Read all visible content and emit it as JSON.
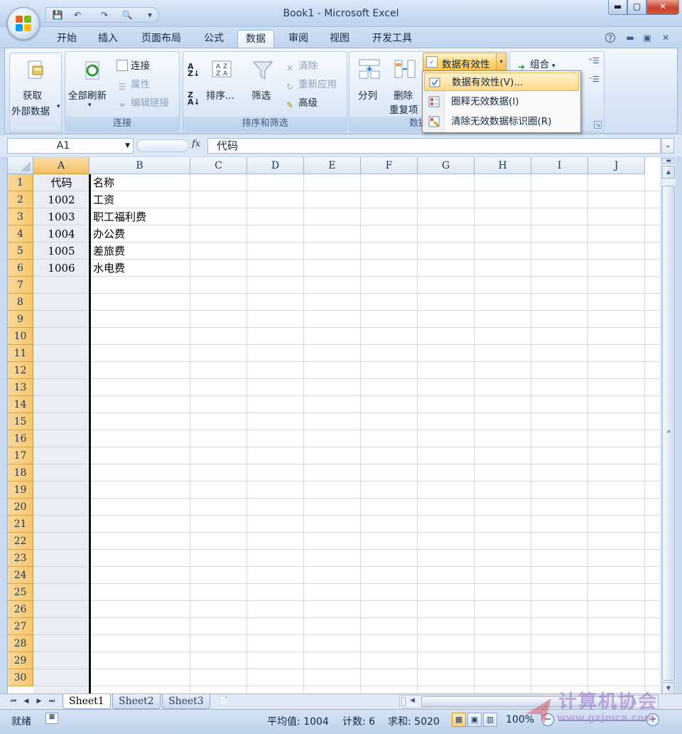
{
  "window": {
    "title": "Book1 - Microsoft Excel",
    "minimize": "▬",
    "maximize": "▢",
    "close": "✕"
  },
  "qat": {
    "save": "💾",
    "undo": "↶",
    "redo": "↷",
    "preview": "🔍",
    "customize": "▾"
  },
  "tabs": [
    "开始",
    "插入",
    "页面布局",
    "公式",
    "数据",
    "审阅",
    "视图",
    "开发工具"
  ],
  "active_tab": "数据",
  "ribbon": {
    "get_external_data": {
      "line1": "获取",
      "line2": "外部数据"
    },
    "connections": {
      "refresh_all": "全部刷新",
      "connections": "连接",
      "properties": "属性",
      "edit_links": "编辑链接",
      "label": "连接"
    },
    "sort_filter": {
      "sort": "排序...",
      "filter": "筛选",
      "clear": "清除",
      "reapply": "重新应用",
      "advanced": "高级",
      "label": "排序和筛选"
    },
    "data_tools": {
      "text_to_columns": "分列",
      "remove_dup_line1": "删除",
      "remove_dup_line2": "重复项",
      "data_validation": "数据有效性",
      "label": "数据"
    },
    "outline": {
      "group": "组合"
    }
  },
  "dropdown_menu": {
    "items": [
      {
        "label": "数据有效性(V)...",
        "highlighted": true
      },
      {
        "label": "圈释无效数据(I)",
        "highlighted": false
      },
      {
        "label": "清除无效数据标识圈(R)",
        "highlighted": false
      }
    ]
  },
  "formula_bar": {
    "name_box": "A1",
    "fx": "fx",
    "value": "代码"
  },
  "sheet": {
    "columns": [
      "A",
      "B",
      "C",
      "D",
      "E",
      "F",
      "G",
      "H",
      "I",
      "J"
    ],
    "selected_column": "A",
    "row_numbers": [
      "1",
      "2",
      "3",
      "4",
      "5",
      "6",
      "7",
      "8",
      "9",
      "10",
      "11",
      "12",
      "13",
      "14",
      "15",
      "16",
      "17",
      "18",
      "19",
      "20",
      "21",
      "22",
      "23",
      "24",
      "25",
      "26",
      "27",
      "28",
      "29",
      "30"
    ],
    "rows": [
      {
        "a": "代码",
        "b": "名称"
      },
      {
        "a": "1002",
        "b": "工资"
      },
      {
        "a": "1003",
        "b": "职工福利费"
      },
      {
        "a": "1004",
        "b": "办公费"
      },
      {
        "a": "1005",
        "b": "差旅费"
      },
      {
        "a": "1006",
        "b": "水电费"
      }
    ]
  },
  "sheet_tabs": [
    "Sheet1",
    "Sheet2",
    "Sheet3"
  ],
  "active_sheet": "Sheet1",
  "status": {
    "mode": "就绪",
    "average": "平均值: 1004",
    "count": "计数: 6",
    "sum": "求和: 5020",
    "zoom": "100%"
  },
  "watermark": {
    "text": "计算机协会",
    "url": "www.gxjmca.com"
  },
  "colors": {
    "accent": "#ffd774",
    "selected_header": "#f6c66d",
    "ribbon": "#dce8f7",
    "close": "#c7402b"
  }
}
